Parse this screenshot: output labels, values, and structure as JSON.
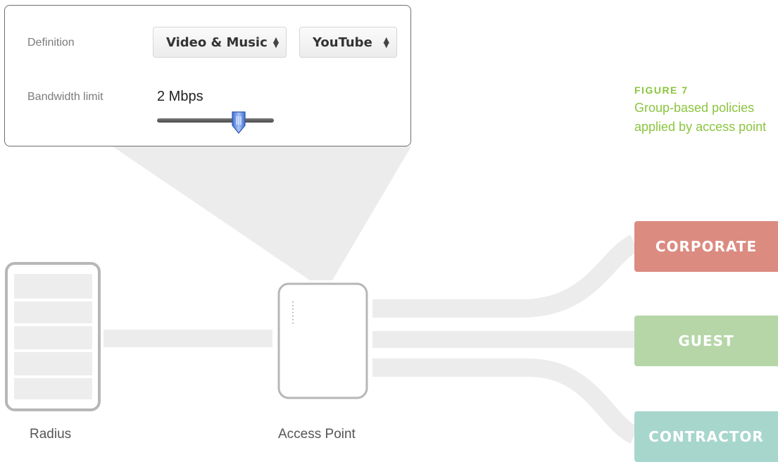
{
  "policy_panel": {
    "definition_label": "Definition",
    "category_select": "Video & Music",
    "app_select": "YouTube",
    "bandwidth_label": "Bandwidth limit",
    "bandwidth_value": "2 Mbps",
    "slider_fraction": 0.7
  },
  "devices": {
    "radius_label": "Radius",
    "access_point_label": "Access Point"
  },
  "figure": {
    "heading": "FIGURE 7",
    "caption": "Group-based policies applied by access point"
  },
  "groups": [
    {
      "label": "CORPORATE",
      "color": "#db8b80"
    },
    {
      "label": "GUEST",
      "color": "#b6d6a8"
    },
    {
      "label": "CONTRACTOR",
      "color": "#a7d6cc"
    }
  ],
  "colors": {
    "connector": "#ececec",
    "device_outline": "#b7b7b7",
    "caption": "#8bc53f"
  }
}
